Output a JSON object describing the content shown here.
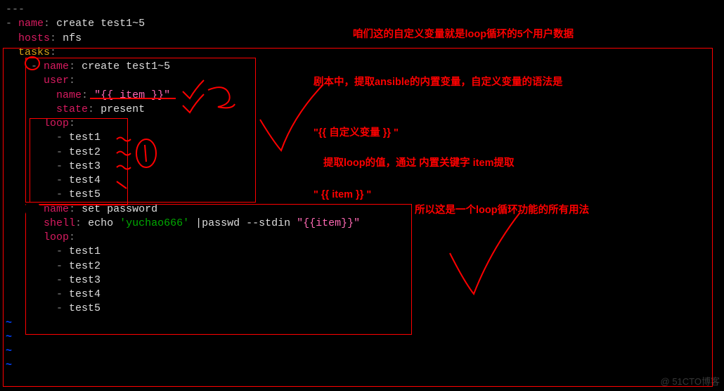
{
  "keywords": {
    "dash3": "---",
    "dash1": "-",
    "name": "name",
    "hosts": "hosts",
    "tasks": "tasks",
    "user": "user",
    "state": "state",
    "loop": "loop",
    "shell": "shell"
  },
  "play": {
    "name": "create test1~5",
    "hosts": "nfs"
  },
  "task1": {
    "title": "create test1~5",
    "user_name": "\"{{ item }}\"",
    "state": "present",
    "loop": [
      "test1",
      "test2",
      "test3",
      "test4",
      "test5"
    ]
  },
  "task2": {
    "title": "set password",
    "shell_cmd_p1": "echo ",
    "shell_cmd_p2": "'yuchao666'",
    "shell_cmd_p3": " |passwd --stdin ",
    "shell_cmd_p4": "\"{{item}}\"",
    "loop": [
      "test1",
      "test2",
      "test3",
      "test4",
      "test5"
    ]
  },
  "anno": {
    "a1": "咱们这的自定义变量就是loop循环的5个用户数据",
    "a2a": "剧本中，提取ansible的内置变量，自定义变量的语法是",
    "a3": "\"{{  自定义变量  }} \"",
    "a4": "提取loop的值，通过 内置关键字 item提取",
    "a5": "\" {{ item }} \"",
    "a6": "所以这是一个loop循环功能的所有用法"
  },
  "watermark": "@ 51CTO博客"
}
